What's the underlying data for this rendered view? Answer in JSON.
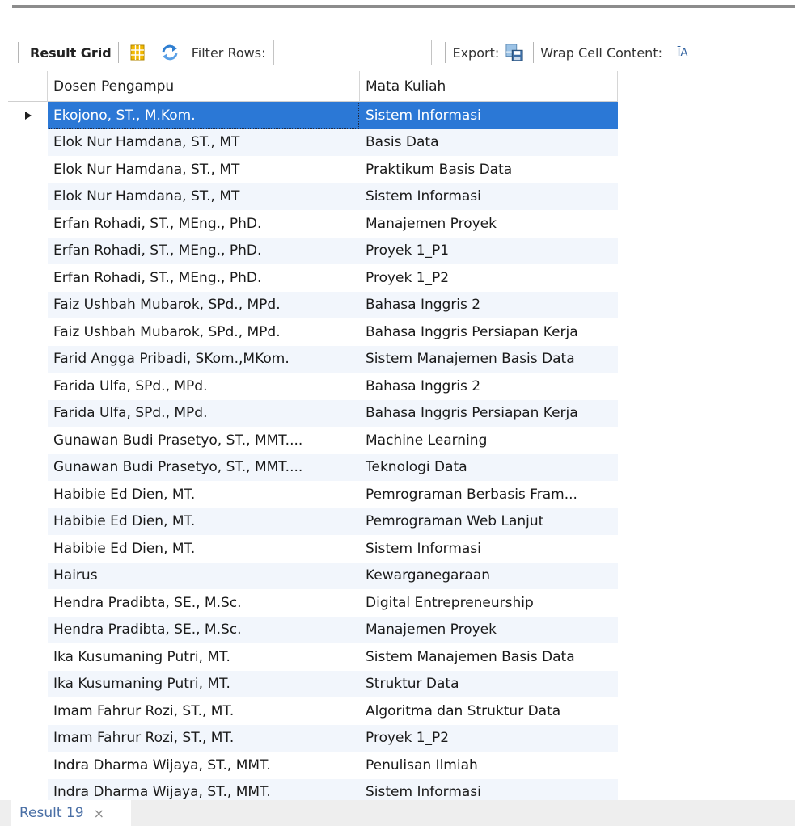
{
  "toolbar": {
    "result_grid_label": "Result Grid",
    "filter_rows_label": "Filter Rows:",
    "filter_rows_value": "",
    "export_label": "Export:",
    "wrap_cell_label": "Wrap Cell Content:",
    "wrap_icon_glyph": "ĪA"
  },
  "grid": {
    "columns": [
      "Dosen Pengampu",
      "Mata Kuliah"
    ],
    "selected_row": 0,
    "rows": [
      [
        "Ekojono, ST., M.Kom.",
        "Sistem Informasi"
      ],
      [
        "Elok Nur Hamdana, ST., MT",
        "Basis Data"
      ],
      [
        "Elok Nur Hamdana, ST., MT",
        "Praktikum Basis Data"
      ],
      [
        "Elok Nur Hamdana, ST., MT",
        "Sistem Informasi"
      ],
      [
        "Erfan Rohadi, ST., MEng., PhD.",
        "Manajemen Proyek"
      ],
      [
        "Erfan Rohadi, ST., MEng., PhD.",
        "Proyek 1_P1"
      ],
      [
        "Erfan Rohadi, ST., MEng., PhD.",
        "Proyek 1_P2"
      ],
      [
        "Faiz Ushbah Mubarok, SPd., MPd.",
        "Bahasa Inggris 2"
      ],
      [
        "Faiz Ushbah Mubarok, SPd., MPd.",
        "Bahasa Inggris Persiapan Kerja"
      ],
      [
        "Farid Angga Pribadi, SKom.,MKom.",
        "Sistem Manajemen Basis Data"
      ],
      [
        "Farida Ulfa, SPd., MPd.",
        "Bahasa Inggris 2"
      ],
      [
        "Farida Ulfa, SPd., MPd.",
        "Bahasa Inggris Persiapan Kerja"
      ],
      [
        "Gunawan Budi Prasetyo, ST., MMT....",
        "Machine Learning"
      ],
      [
        "Gunawan Budi Prasetyo, ST., MMT....",
        "Teknologi Data"
      ],
      [
        "Habibie Ed Dien, MT.",
        "Pemrograman Berbasis Fram..."
      ],
      [
        "Habibie Ed Dien, MT.",
        "Pemrograman Web Lanjut"
      ],
      [
        "Habibie Ed Dien, MT.",
        "Sistem Informasi"
      ],
      [
        "Hairus",
        "Kewarganegaraan"
      ],
      [
        "Hendra Pradibta, SE., M.Sc.",
        "Digital Entrepreneurship"
      ],
      [
        "Hendra Pradibta, SE., M.Sc.",
        "Manajemen Proyek"
      ],
      [
        "Ika Kusumaning Putri, MT.",
        "Sistem Manajemen Basis Data"
      ],
      [
        "Ika Kusumaning Putri, MT.",
        "Struktur Data"
      ],
      [
        "Imam Fahrur Rozi, ST., MT.",
        "Algoritma dan Struktur Data"
      ],
      [
        "Imam Fahrur Rozi, ST., MT.",
        "Proyek 1_P2"
      ],
      [
        "Indra Dharma Wijaya, ST., MMT.",
        "Penulisan Ilmiah"
      ],
      [
        "Indra Dharma Wijaya, ST., MMT.",
        "Sistem Informasi"
      ]
    ]
  },
  "bottom": {
    "tab_label": "Result 19",
    "close_glyph": "×"
  },
  "colors": {
    "selection": "#2b78d6",
    "grid_icon": "#f2b800",
    "refresh_icon": "#2f7fd1",
    "tab_text": "#4a6fa5"
  }
}
